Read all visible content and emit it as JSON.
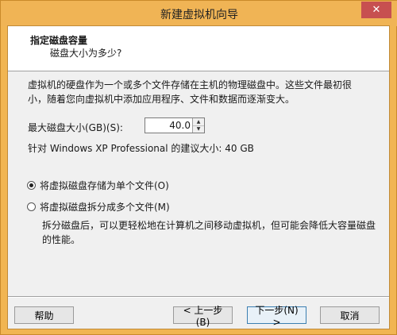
{
  "window": {
    "title": "新建虚拟机向导",
    "close_glyph": "✕"
  },
  "header": {
    "title": "指定磁盘容量",
    "subtitle": "磁盘大小为多少?"
  },
  "intro_text": "虚拟机的硬盘作为一个或多个文件存储在主机的物理磁盘中。这些文件最初很小，随着您向虚拟机中添加应用程序、文件和数据而逐渐变大。",
  "disk_size": {
    "label": "最大磁盘大小(GB)(S):",
    "value": "40.0",
    "up_glyph": "▲",
    "down_glyph": "▼"
  },
  "recommendation": "针对 Windows XP Professional 的建议大小: 40 GB",
  "storage_options": [
    {
      "label": "将虚拟磁盘存储为单个文件(O)",
      "selected": true
    },
    {
      "label": "将虚拟磁盘拆分成多个文件(M)",
      "selected": false
    }
  ],
  "split_description": "拆分磁盘后，可以更轻松地在计算机之间移动虚拟机，但可能会降低大容量磁盘的性能。",
  "buttons": {
    "help": "帮助",
    "back": "< 上一步(B)",
    "next": "下一步(N) >",
    "cancel": "取消"
  }
}
